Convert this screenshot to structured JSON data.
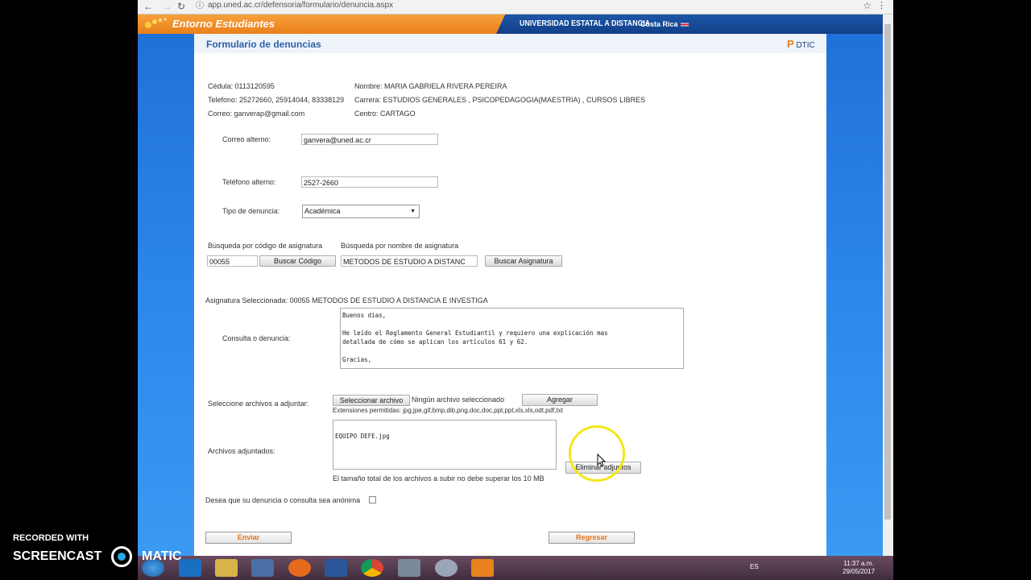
{
  "browser": {
    "url": "app.uned.ac.cr/defensoria/formulario/denuncia.aspx",
    "back": "←",
    "forward": "→",
    "reload": "↻",
    "info": "ⓘ",
    "star": "☆",
    "menu": "⋮"
  },
  "header": {
    "brand": "Entorno Estudiantes",
    "university": "UNIVERSIDAD ESTATAL A DISTANCIA",
    "country": "Costa Rica"
  },
  "form": {
    "title": "Formulario de denuncias",
    "logo_letter": "P",
    "logo_text": "DTIC",
    "student": {
      "cedula": "Cédula: 0113120595",
      "telefono": "Telefono: 25272660, 25914044, 83338129",
      "correo": "Correo: ganverap@gmail.com",
      "nombre": "Nombre: MARIA GABRIELA RIVERA PEREIRA",
      "carrera": "Carrera: ESTUDIOS GENERALES , PSICOPEDAGOGIA(MAESTRIA) , CURSOS LIBRES",
      "centro": "Centro: CARTAGO"
    },
    "correo_alterno_label": "Correo alterno:",
    "correo_alterno_value": "ganvera@uned.ac.cr",
    "telefono_alterno_label": "Teléfono alterno:",
    "telefono_alterno_value": "2527-2660",
    "tipo_label": "Tipo de denuncia:",
    "tipo_value": "Académica",
    "busqueda_codigo_label": "Búsqueda por código de asignatura",
    "busqueda_nombre_label": "Búsqueda por nombre de asignatura",
    "codigo_value": "00055",
    "buscar_codigo": "Buscar Código",
    "nombre_value": "METODOS DE ESTUDIO A DISTANC",
    "buscar_asignatura": "Buscar Asignatura",
    "asignatura_seleccionada": "Asignatura Seleccionada: 00055   METODOS DE ESTUDIO A DISTANCIA E INVESTIGA",
    "consulta_label": "Consulta o denuncia:",
    "consulta_text": "Buenos días,\n\nHe leído el Reglamento General Estudiantil y requiero una explicación mas\ndetallada de cómo se aplican los artículos 61 y 62.\n\nGracias,",
    "archivos_label": "Seleccione archivos a adjuntar:",
    "seleccionar_archivo": "Seleccionar archivo",
    "ningun_archivo": "Ningún archivo seleccionado",
    "agregar": "Agregar",
    "extensiones": "Extensiones permitidas: jpg,jpe,gif,bmp,dib,png,doc,doc,ppt,ppt,xls,xls,odt,pdf,txt",
    "adjuntos_label": "Archivos adjuntados:",
    "adjuntos_text": "\nEQUIPO DEFE.jpg",
    "eliminar_adjuntos": "Eliminar adjuntos",
    "tamano_nota": "El tamaño total de los archivos a subir no debe superar los 10 MB",
    "anonima_label": "Desea que su denuncia o consulta sea anónima",
    "enviar": "Enviar",
    "regresar": "Regresar"
  },
  "taskbar": {
    "lang": "ES",
    "time": "11:37 a.m.",
    "date": "29/05/2017"
  },
  "watermark": {
    "line1": "RECORDED WITH",
    "line2": "SCREENCAST",
    "line3": "MATIC"
  },
  "colors": {
    "accent_orange": "#e3741b",
    "header_blue": "#1c56a8",
    "title_blue": "#2b5fa6"
  }
}
